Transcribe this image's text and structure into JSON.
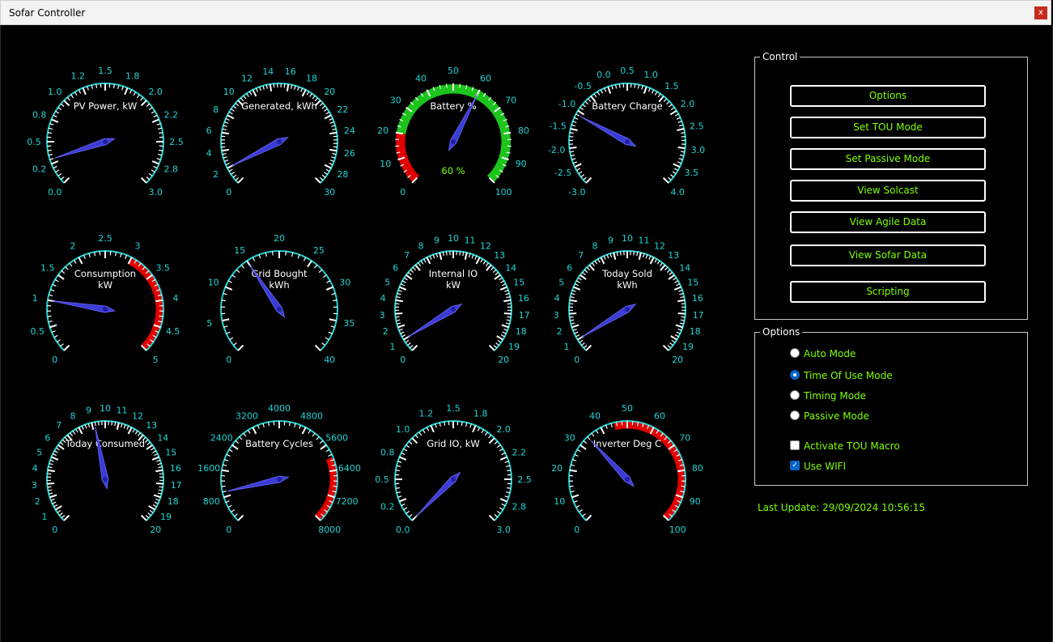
{
  "window": {
    "title": "Sofar Controller",
    "close_label": "x"
  },
  "control": {
    "legend": "Control",
    "buttons": [
      "Options",
      "Set TOU Mode",
      "Set Passive Mode",
      "View Solcast",
      "View Agile Data",
      "View Sofar Data",
      "Scripting"
    ]
  },
  "options": {
    "legend": "Options",
    "modes": [
      {
        "label": "Auto Mode",
        "selected": false
      },
      {
        "label": "Time Of Use Mode",
        "selected": true
      },
      {
        "label": "Timing Mode",
        "selected": false
      },
      {
        "label": "Passive Mode",
        "selected": false
      }
    ],
    "checks": [
      {
        "label": "Activate TOU Macro",
        "checked": false
      },
      {
        "label": "Use WIFI",
        "checked": true
      }
    ]
  },
  "status": {
    "last_update": "Last Update: 29/09/2024 10:56:15"
  },
  "colors": {
    "accent": "#7fff00",
    "dial": "#21d4d4",
    "needle": "#3b3bd6",
    "danger": "#e00000",
    "good": "#1cc41c"
  },
  "gauges": [
    {
      "name": "pv-power",
      "title": [
        "PV Power, kW"
      ],
      "min": 0,
      "max": 3,
      "value": 0.3,
      "labels": [
        "0.0",
        "0.2",
        "0.5",
        "0.8",
        "1.0",
        "1.2",
        "1.5",
        "1.8",
        "2.0",
        "2.2",
        "2.5",
        "2.8",
        "3.0"
      ],
      "minor": 5,
      "fill": false,
      "bands": []
    },
    {
      "name": "generated",
      "title": [
        "Generated, kWh"
      ],
      "min": 0,
      "max": 30,
      "value": 2,
      "labels": [
        "0",
        "2",
        "4",
        "6",
        "8",
        "10",
        "12",
        "14",
        "16",
        "18",
        "20",
        "22",
        "24",
        "26",
        "28",
        "30"
      ],
      "minor": 5,
      "fill": false,
      "bands": []
    },
    {
      "name": "battery-percent",
      "title": [
        "Battery %"
      ],
      "min": 0,
      "max": 100,
      "value": 60,
      "labels": [
        "0",
        "10",
        "20",
        "30",
        "40",
        "50",
        "60",
        "70",
        "80",
        "90",
        "100"
      ],
      "minor": 4,
      "fill": true,
      "readout": "60 %",
      "bands": [
        {
          "from": 0,
          "to": 20,
          "color": "#e00000"
        },
        {
          "from": 20,
          "to": 100,
          "color": "#1cc41c"
        }
      ]
    },
    {
      "name": "battery-charge",
      "title": [
        "Battery Charge"
      ],
      "min": -3,
      "max": 4,
      "value": -1.1,
      "labels": [
        "-3.0",
        "-2.5",
        "-2.0",
        "-1.5",
        "-1.0",
        "-0.5",
        "0.0",
        "0.5",
        "1.0",
        "1.5",
        "2.0",
        "2.5",
        "3.0",
        "3.5",
        "4.0"
      ],
      "minor": 5,
      "fill": false,
      "bands": []
    },
    {
      "name": "consumption",
      "title": [
        "Consumption",
        "kW"
      ],
      "min": 0,
      "max": 5,
      "value": 1,
      "labels": [
        "0",
        "0.5",
        "1",
        "1.5",
        "2",
        "2.5",
        "3",
        "3.5",
        "4",
        "4.5",
        "5"
      ],
      "minor": 5,
      "fill": false,
      "bands": [
        {
          "from": 3,
          "to": 5,
          "color": "#e00000"
        }
      ]
    },
    {
      "name": "grid-bought",
      "title": [
        "Grid Bought",
        "kWh"
      ],
      "min": 0,
      "max": 40,
      "value": 15,
      "labels": [
        "0",
        "5",
        "10",
        "15",
        "20",
        "25",
        "30",
        "35",
        "40"
      ],
      "minor": 5,
      "fill": false,
      "bands": []
    },
    {
      "name": "internal-io",
      "title": [
        "Internal IO",
        "kW"
      ],
      "min": 0,
      "max": 20,
      "value": 1,
      "labels": [
        "0",
        "1",
        "2",
        "3",
        "4",
        "5",
        "6",
        "7",
        "8",
        "9",
        "10",
        "11",
        "12",
        "13",
        "14",
        "15",
        "16",
        "17",
        "18",
        "19",
        "20"
      ],
      "minor": 4,
      "fill": false,
      "bands": []
    },
    {
      "name": "today-sold",
      "title": [
        "Today Sold",
        "kWh"
      ],
      "min": 0,
      "max": 20,
      "value": 1,
      "labels": [
        "0",
        "1",
        "2",
        "3",
        "4",
        "5",
        "6",
        "7",
        "8",
        "9",
        "10",
        "11",
        "12",
        "13",
        "14",
        "15",
        "16",
        "17",
        "18",
        "19",
        "20"
      ],
      "minor": 4,
      "fill": false,
      "bands": []
    },
    {
      "name": "today-consumed",
      "title": [
        "Today Consumed"
      ],
      "min": 0,
      "max": 20,
      "value": 9.2,
      "labels": [
        "0",
        "1",
        "2",
        "3",
        "4",
        "5",
        "6",
        "7",
        "8",
        "9",
        "10",
        "11",
        "12",
        "13",
        "14",
        "15",
        "16",
        "17",
        "18",
        "19",
        "20"
      ],
      "minor": 4,
      "fill": false,
      "bands": []
    },
    {
      "name": "battery-cycles",
      "title": [
        "Battery Cycles"
      ],
      "min": 0,
      "max": 8000,
      "value": 950,
      "labels": [
        "0",
        "800",
        "1600",
        "2400",
        "3200",
        "4000",
        "4800",
        "5600",
        "6400",
        "7200",
        "8000"
      ],
      "minor": 5,
      "fill": false,
      "bands": [
        {
          "from": 6000,
          "to": 8000,
          "color": "#e00000"
        }
      ]
    },
    {
      "name": "grid-io",
      "title": [
        "Grid IO, kW"
      ],
      "min": 0,
      "max": 3,
      "value": 0.0,
      "labels": [
        "0.0",
        "0.2",
        "0.5",
        "0.8",
        "1.0",
        "1.2",
        "1.5",
        "1.8",
        "2.0",
        "2.2",
        "2.5",
        "2.8",
        "3.0"
      ],
      "minor": 5,
      "fill": false,
      "bands": []
    },
    {
      "name": "inverter-deg-c",
      "title": [
        "Inverter Deg C"
      ],
      "min": 0,
      "max": 100,
      "value": 34,
      "labels": [
        "0",
        "10",
        "20",
        "30",
        "40",
        "50",
        "60",
        "70",
        "80",
        "90",
        "100"
      ],
      "minor": 5,
      "fill": false,
      "bands": [
        {
          "from": 45,
          "to": 100,
          "color": "#e00000"
        }
      ]
    }
  ]
}
